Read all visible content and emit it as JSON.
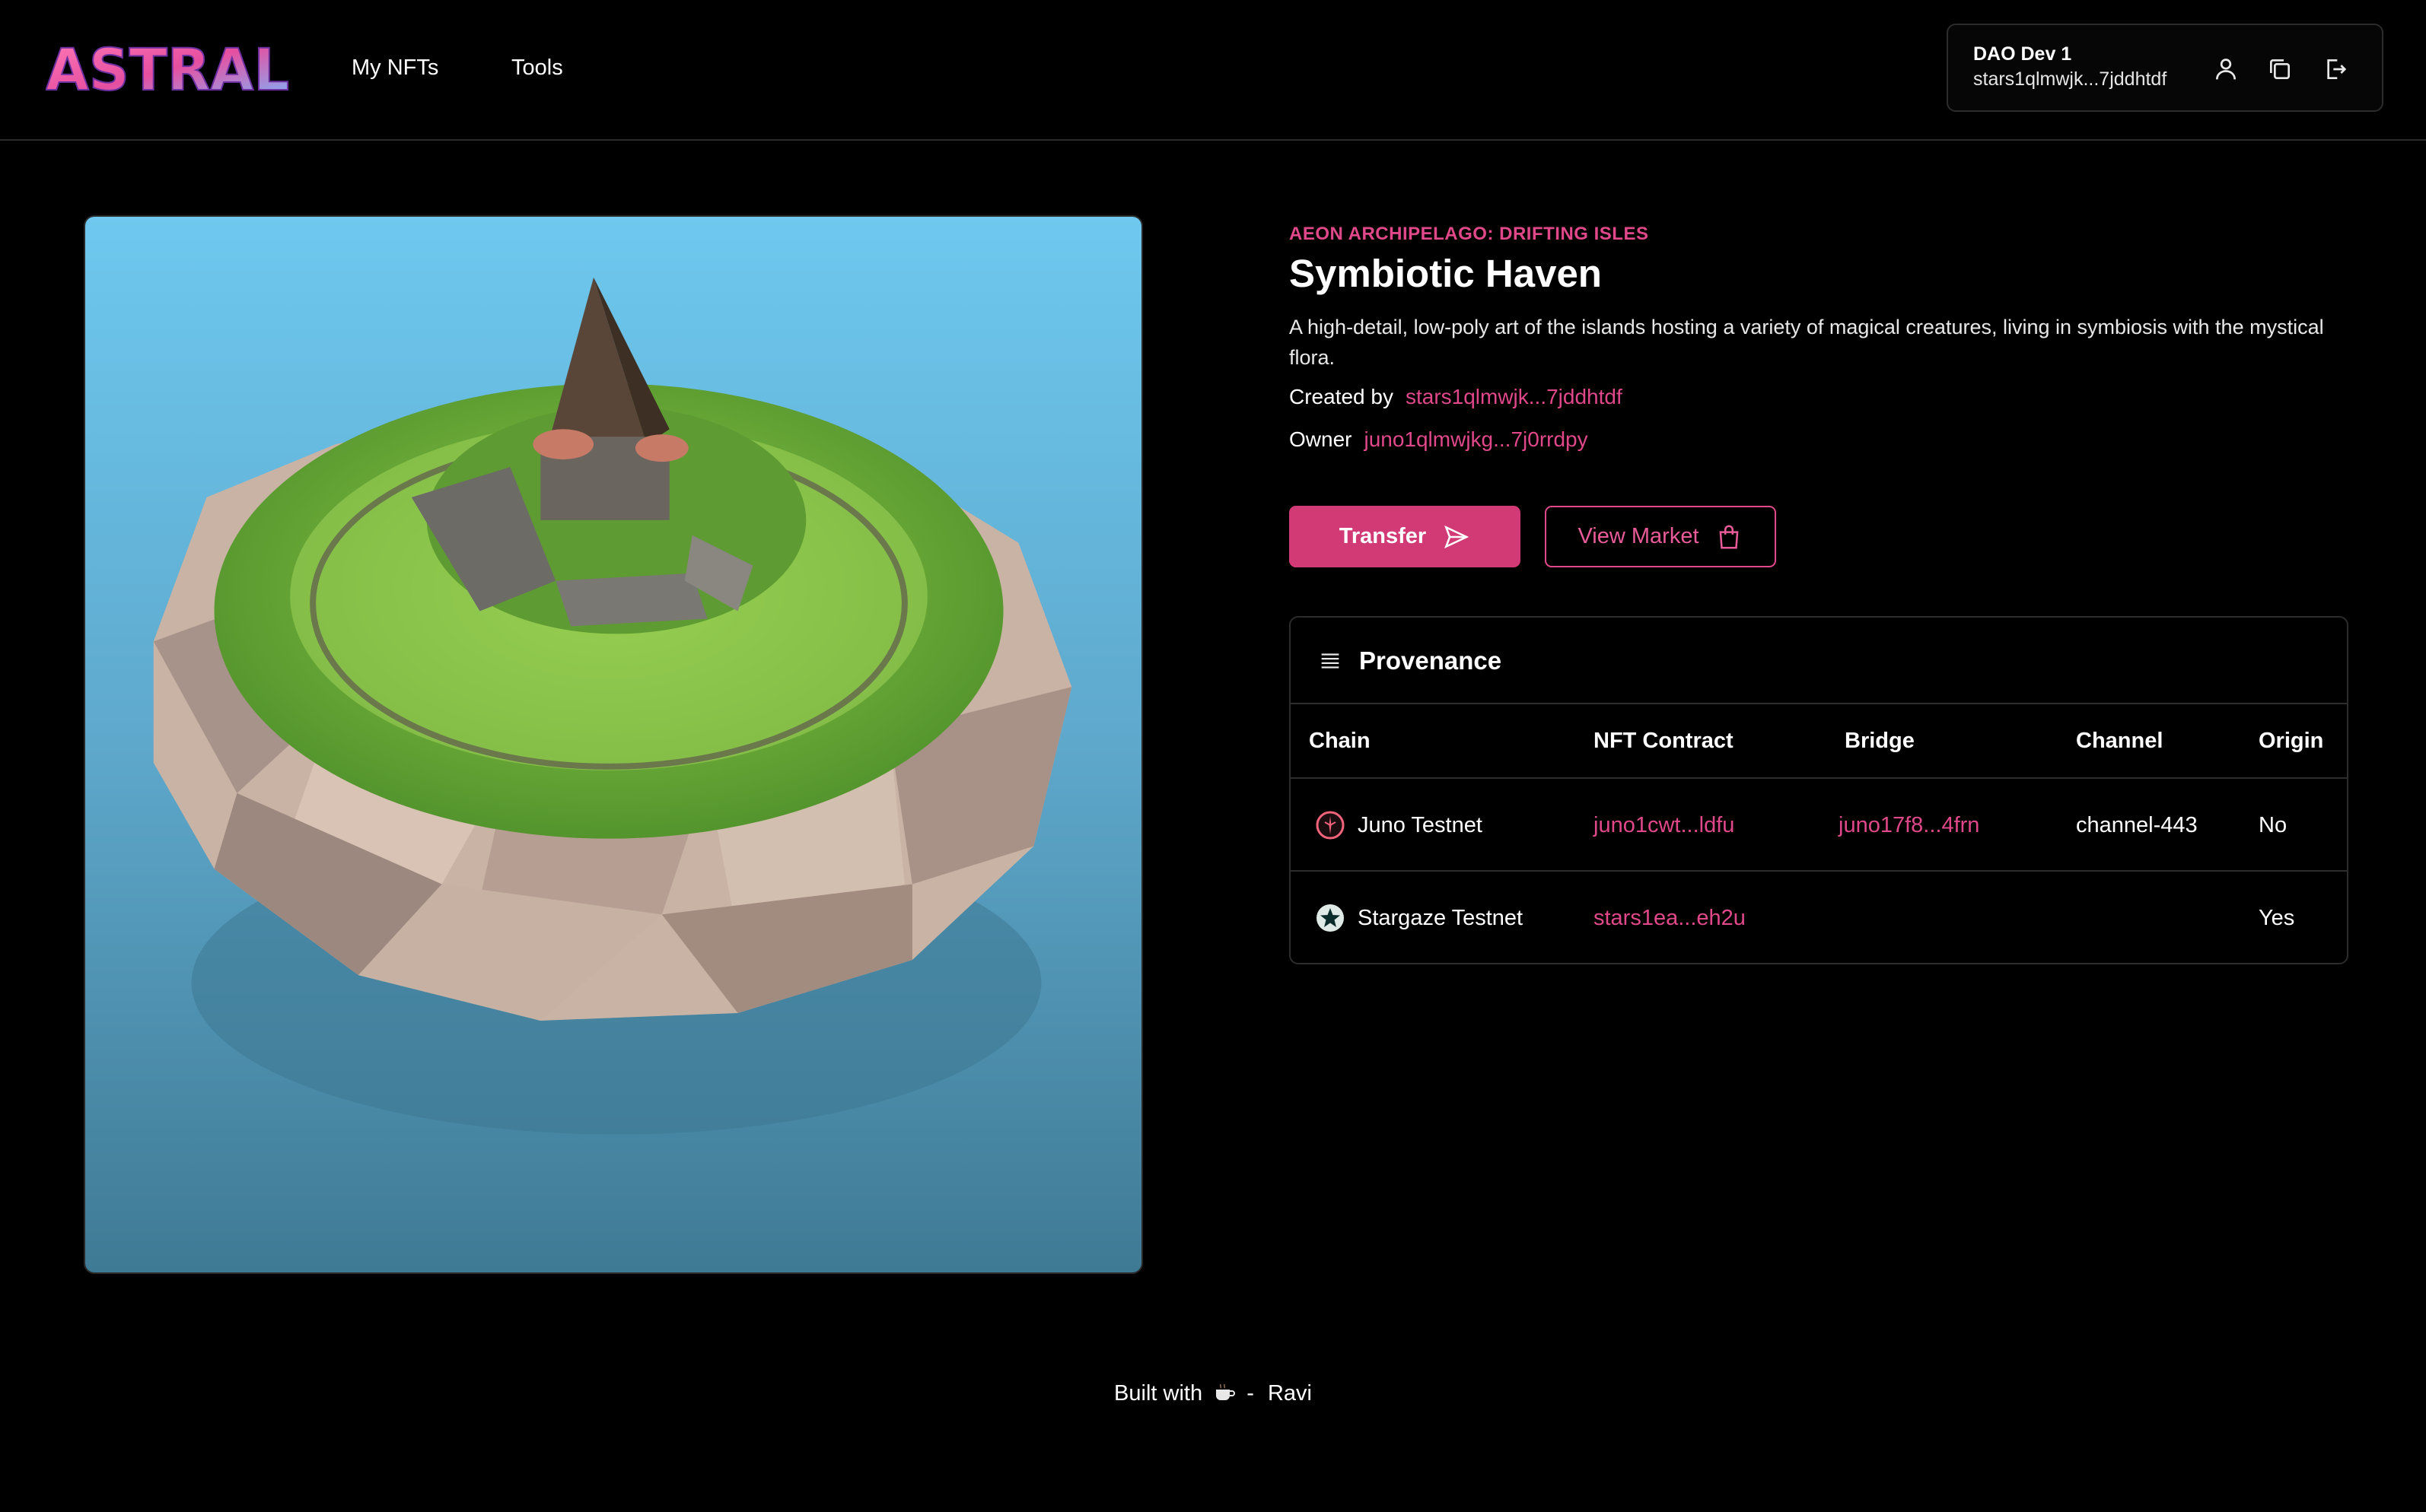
{
  "header": {
    "logo_text": "ASTRAL",
    "nav": [
      {
        "label": "My NFTs"
      },
      {
        "label": "Tools"
      }
    ],
    "wallet": {
      "name": "DAO Dev 1",
      "address": "stars1qlmwjk...7jddhtdf",
      "icons": [
        "user-icon",
        "copy-icon",
        "logout-icon"
      ]
    }
  },
  "nft": {
    "collection": "AEON ARCHIPELAGO: DRIFTING ISLES",
    "title": "Symbiotic Haven",
    "description": "A high-detail, low-poly art of the islands hosting a variety of magical creatures, living in symbiosis with the mystical flora.",
    "created_by_label": "Created by",
    "created_by": "stars1qlmwjk...7jddhtdf",
    "owner_label": "Owner",
    "owner": "juno1qlmwjkg...7j0rrdpy"
  },
  "actions": {
    "transfer_label": "Transfer",
    "market_label": "View Market"
  },
  "provenance": {
    "title": "Provenance",
    "columns": [
      "Chain",
      "NFT Contract",
      "Bridge",
      "Channel",
      "Origin"
    ],
    "rows": [
      {
        "chain": "Juno Testnet",
        "chain_icon": "juno-icon",
        "contract": "juno1cwt...ldfu",
        "bridge": "juno17f8...4frn",
        "channel": "channel-443",
        "origin": "No"
      },
      {
        "chain": "Stargaze Testnet",
        "chain_icon": "stargaze-icon",
        "contract": "stars1ea...eh2u",
        "bridge": "",
        "channel": "",
        "origin": "Yes"
      }
    ]
  },
  "footer": {
    "prefix": "Built with",
    "separator": "-",
    "author": "Ravi"
  },
  "colors": {
    "accent": "#e0488a",
    "button": "#d23a76",
    "background": "#000000"
  }
}
